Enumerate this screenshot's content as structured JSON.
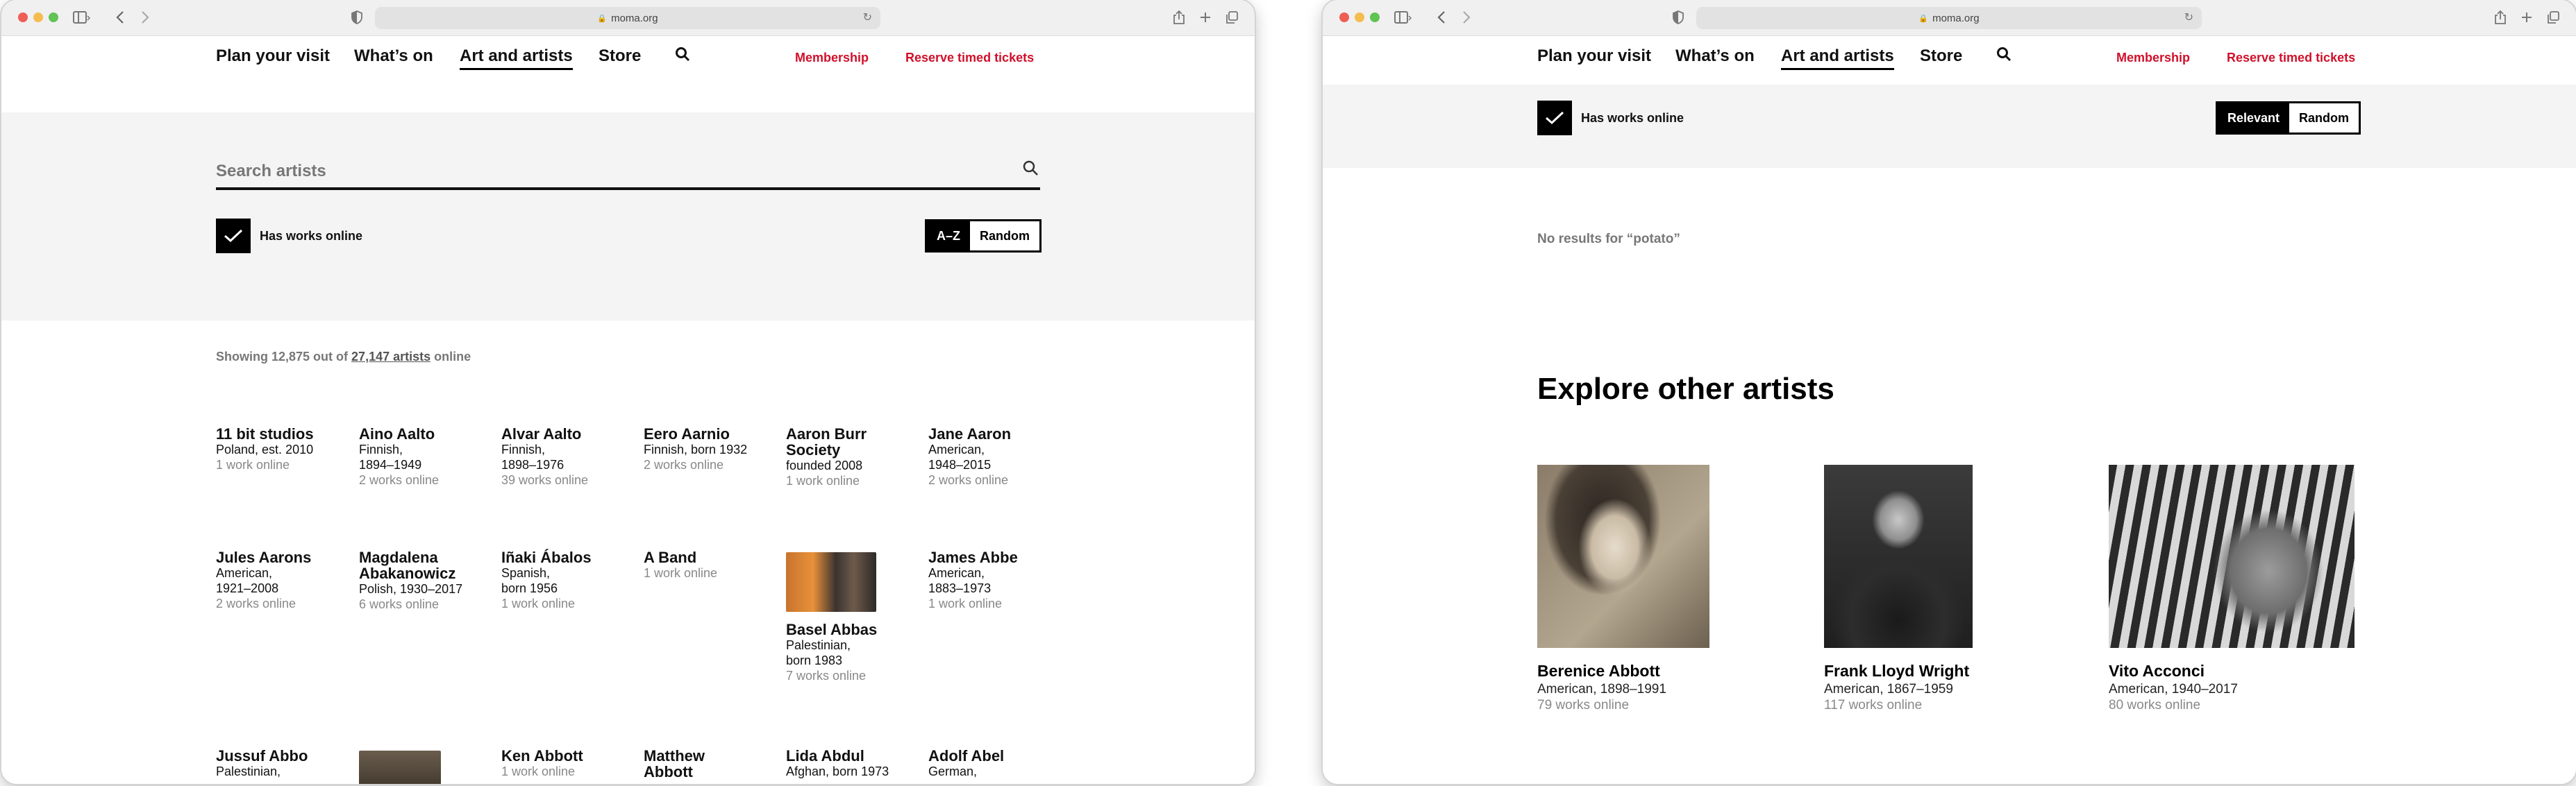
{
  "browser": {
    "url": "moma.org"
  },
  "nav": {
    "links": [
      "Plan your visit",
      "What’s on",
      "Art and artists",
      "Store"
    ],
    "membership": "Membership",
    "tickets": "Reserve timed tickets"
  },
  "left": {
    "search_placeholder": "Search artists",
    "filter_label": "Has works online",
    "sort": {
      "selected": "A–Z",
      "other": "Random"
    },
    "count": {
      "prefix": "Showing 12,875 out of",
      "total": "27,147 artists",
      "suffix": "online"
    },
    "artists": [
      {
        "name": "11 bit studios",
        "meta": "Poland, est. 2010",
        "works": "1 work online"
      },
      {
        "name": "Aino Aalto",
        "meta": "Finnish, 1894–1949",
        "works": "2 works online"
      },
      {
        "name": "Alvar Aalto",
        "meta": "Finnish, 1898–1976",
        "works": "39 works online"
      },
      {
        "name": "Eero Aarnio",
        "meta": "Finnish, born 1932",
        "works": "2 works online"
      },
      {
        "name": "Aaron Burr Society",
        "meta": "founded 2008",
        "works": "1 work online"
      },
      {
        "name": "Jane Aaron",
        "meta": "American, 1948–2015",
        "works": "2 works online"
      },
      {
        "name": "Jules Aarons",
        "meta": "American, 1921–2008",
        "works": "2 works online"
      },
      {
        "name": "Magdalena Abakanowicz",
        "meta": "Polish, 1930–2017",
        "works": "6 works online"
      },
      {
        "name": "Iñaki Ábalos",
        "meta": "Spanish, born 1956",
        "works": "1 work online"
      },
      {
        "name": "A Band",
        "meta": "",
        "works": "1 work online"
      },
      {
        "name": "Basel Abbas",
        "meta": "Palestinian, born 1983",
        "works": "7 works online"
      },
      {
        "name": "James Abbe",
        "meta": "American, 1883–1973",
        "works": "1 work online"
      },
      {
        "name": "Jussuf Abbo",
        "meta": "Palestinian,",
        "works": ""
      },
      {
        "name": "",
        "meta": "",
        "works": ""
      },
      {
        "name": "Ken Abbott",
        "meta": "",
        "works": "1 work online"
      },
      {
        "name": "Matthew Abbott",
        "meta": "",
        "works": ""
      },
      {
        "name": "Lida Abdul",
        "meta": "Afghan, born 1973",
        "works": ""
      },
      {
        "name": "Adolf Abel",
        "meta": "German,",
        "works": ""
      }
    ]
  },
  "right": {
    "filter_label": "Has works online",
    "sort": {
      "selected": "Relevant",
      "other": "Random"
    },
    "no_results": "No results for “potato”",
    "explore_title": "Explore other artists",
    "cards": [
      {
        "name": "Berenice Abbott",
        "meta": "American, 1898–1991",
        "works": "79 works online"
      },
      {
        "name": "Frank Lloyd Wright",
        "meta": "American, 1867–1959",
        "works": "117 works online"
      },
      {
        "name": "Vito Acconci",
        "meta": "American, 1940–2017",
        "works": "80 works online"
      }
    ]
  }
}
